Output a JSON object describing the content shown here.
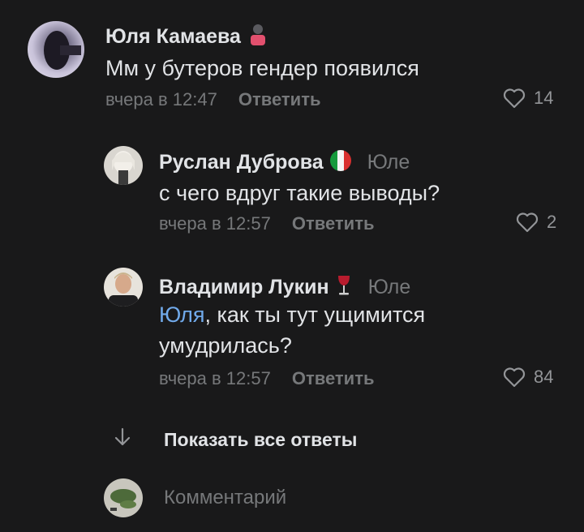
{
  "comments": [
    {
      "author": "Юля Камаева",
      "emoji": "woman-icon",
      "text": "Мм у бутеров гендер появился",
      "time": "вчера в 12:47",
      "reply_label": "Ответить",
      "likes": "14"
    },
    {
      "author": "Руслан Дуброва",
      "emoji": "italy-flag-icon",
      "reply_to": "Юле",
      "text": "с чего вдруг такие выводы?",
      "time": "вчера в 12:57",
      "reply_label": "Ответить",
      "likes": "2"
    },
    {
      "author": "Владимир Лукин",
      "emoji": "wine-glass-icon",
      "reply_to": "Юле",
      "mention": "Юля",
      "text_line1_rest": ", как ты тут ущимится",
      "text_line2": "умудрилась?",
      "time": "вчера в 12:57",
      "reply_label": "Ответить",
      "likes": "84"
    }
  ],
  "show_all": {
    "label": "Показать все ответы",
    "icon": "arrow-down-icon"
  },
  "composer": {
    "placeholder": "Комментарий"
  },
  "colors": {
    "background": "#19191a",
    "text": "#e1e3e6",
    "secondary": "#76787a",
    "link": "#71aaeb"
  }
}
